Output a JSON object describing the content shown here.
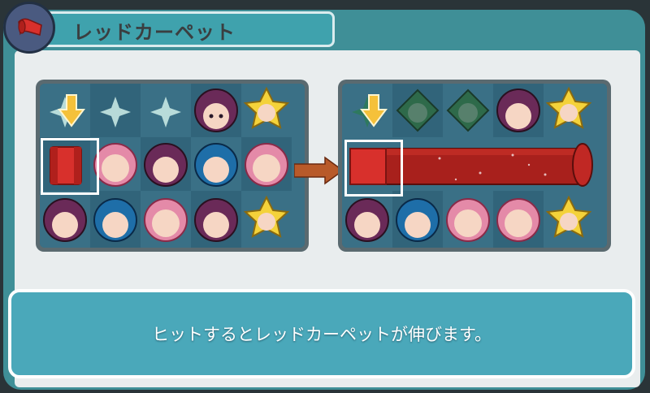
{
  "header": {
    "title": "レッドカーペット",
    "icon": "red-carpet-icon"
  },
  "demo": {
    "before_board": {
      "rows": [
        [
          "sparkle",
          "sparkle",
          "sparkle",
          "purple-hair-face",
          "yellow-star-face"
        ],
        [
          "red-carpet-tile",
          "pink-ribbon-face",
          "purple-hair-face",
          "blue-hair-face",
          "pink-ribbon-face"
        ],
        [
          "purple-hair-face",
          "blue-hair-face",
          "pink-ribbon-face",
          "purple-hair-face",
          "yellow-star-face"
        ]
      ]
    },
    "after_board": {
      "rows": [
        [
          "sparkle",
          "green-face-faded",
          "green-face-faded",
          "purple-hair-face",
          "yellow-star-face"
        ],
        [
          "red-carpet-extended",
          "red-carpet-extended",
          "red-carpet-extended",
          "red-carpet-extended",
          "red-carpet-extended"
        ],
        [
          "purple-hair-face",
          "blue-hair-face",
          "pink-ribbon-face",
          "pink-ribbon-face",
          "yellow-star-face"
        ]
      ]
    },
    "transition_icon": "right-arrow-icon",
    "drop_indicator_icon": "down-arrow-icon"
  },
  "message": "ヒットするとレッドカーペットが伸びます。",
  "colors": {
    "panel": "#3f8f97",
    "header": "#3fa2ad",
    "textbox": "#4aa8ba",
    "carpet_red": "#d8302c",
    "arrow_gold": "#f5c13a"
  }
}
